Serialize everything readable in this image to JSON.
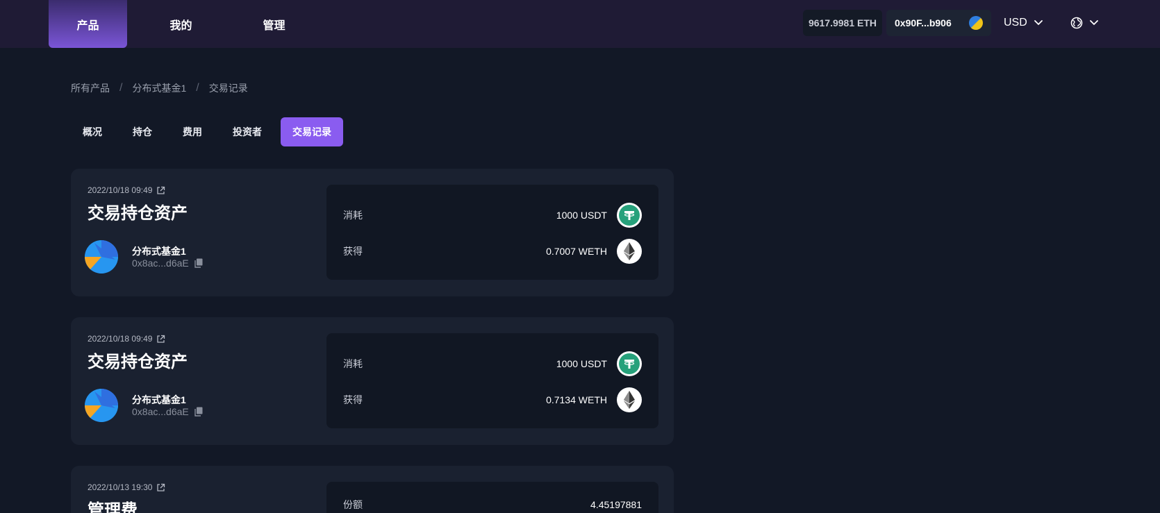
{
  "topbar": {
    "nav": [
      {
        "label": "产品",
        "active": true
      },
      {
        "label": "我的",
        "active": false
      },
      {
        "label": "管理",
        "active": false
      }
    ],
    "balance": "9617.9981 ETH",
    "wallet_address": "0x90F...b906",
    "currency": "USD"
  },
  "breadcrumb": [
    "所有产品",
    "分布式基金1",
    "交易记录"
  ],
  "tabs": [
    {
      "label": "概况",
      "active": false
    },
    {
      "label": "持仓",
      "active": false
    },
    {
      "label": "费用",
      "active": false
    },
    {
      "label": "投资者",
      "active": false
    },
    {
      "label": "交易记录",
      "active": true
    }
  ],
  "transactions": [
    {
      "datetime": "2022/10/18 09:49",
      "title": "交易持仓资产",
      "fund_name": "分布式基金1",
      "fund_address": "0x8ac...d6aE",
      "rows": [
        {
          "label": "消耗",
          "value": "1000 USDT",
          "token": "usdt-icon"
        },
        {
          "label": "获得",
          "value": "0.7007 WETH",
          "token": "eth-icon"
        }
      ]
    },
    {
      "datetime": "2022/10/18 09:49",
      "title": "交易持仓资产",
      "fund_name": "分布式基金1",
      "fund_address": "0x8ac...d6aE",
      "rows": [
        {
          "label": "消耗",
          "value": "1000 USDT",
          "token": "usdt-icon"
        },
        {
          "label": "获得",
          "value": "0.7134 WETH",
          "token": "eth-icon"
        }
      ]
    },
    {
      "datetime": "2022/10/13 19:30",
      "title": "管理费",
      "rows": [
        {
          "label": "份额",
          "value": "4.45197881"
        }
      ]
    }
  ],
  "colors": {
    "background": "#121826",
    "topbar": "#1f1b35",
    "accent": "#8a5cf0",
    "card": "#1a2130",
    "inner_panel": "#111723",
    "usdt": "#26a17b"
  }
}
